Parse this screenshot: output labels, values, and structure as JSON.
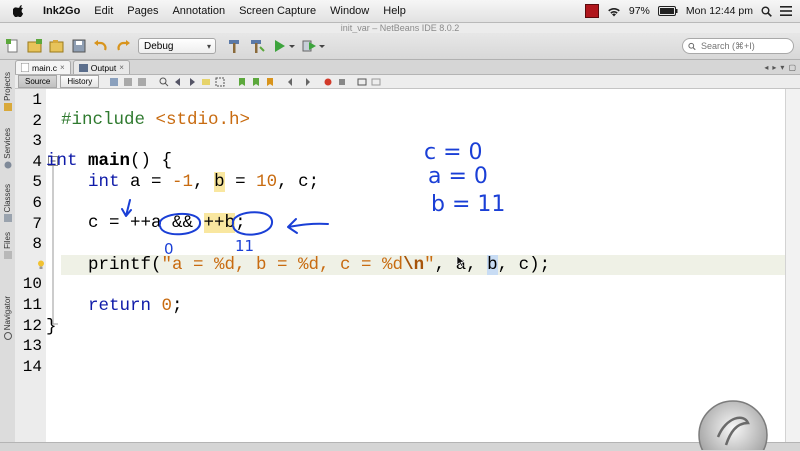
{
  "menubar": {
    "app_name": "Ink2Go",
    "items": [
      "Edit",
      "Pages",
      "Annotation",
      "Screen Capture",
      "Window",
      "Help"
    ],
    "battery": "97%",
    "clock": "Mon 12:44 pm"
  },
  "window": {
    "title": "init_var – NetBeans IDE 8.0.2"
  },
  "toolbar": {
    "configuration": "Debug",
    "search_placeholder": "Search (⌘+I)"
  },
  "side_tabs": [
    "Projects",
    "Services",
    "Classes",
    "Files",
    "Navigator"
  ],
  "file_tabs": [
    {
      "label": "main.c",
      "active": true
    },
    {
      "label": "Output",
      "active": false
    }
  ],
  "editor_toolbar": {
    "source_label": "Source",
    "history_label": "History"
  },
  "line_numbers": [
    "1",
    "2",
    "3",
    "4",
    "5",
    "6",
    "7",
    "8",
    "9",
    "10",
    "11",
    "12",
    "13",
    "14"
  ],
  "code": {
    "line2_directive": "#include",
    "line2_header": "<stdio.h>",
    "line4_type": "int",
    "line4_name": "main",
    "line4_rest": "() {",
    "line5_type": "int",
    "line5_a": "a = ",
    "line5_neg1": "-1",
    "line5_sep1": ", ",
    "line5_b": "b",
    "line5_eq": " = ",
    "line5_ten": "10",
    "line5_end": ", c;",
    "line7_c": "c = ",
    "line7_pa": "++a",
    "line7_and": " && ",
    "line7_pb": "++b",
    "line7_end": ";",
    "line9_fn": "printf(",
    "line9_str": "\"a = %d, b = %d, c = %d",
    "line9_esc": "\\n",
    "line9_quote": "\"",
    "line9_args1": ", a, ",
    "line9_b": "b",
    "line9_args2": ", c);",
    "line11_kw": "return",
    "line11_sp": " ",
    "line11_zero": "0",
    "line11_end": ";",
    "line12_brace": "}"
  },
  "annotations": {
    "color": "#1a3fd6",
    "notes": [
      "c = 0",
      "a = 0",
      "b = 11"
    ],
    "under_a": "0",
    "under_b": "11"
  },
  "colors": {
    "keyword": "#0e1aa8",
    "string": "#c86b10",
    "preprocessor": "#2f7a2f",
    "current_line": "#eff1e6"
  }
}
